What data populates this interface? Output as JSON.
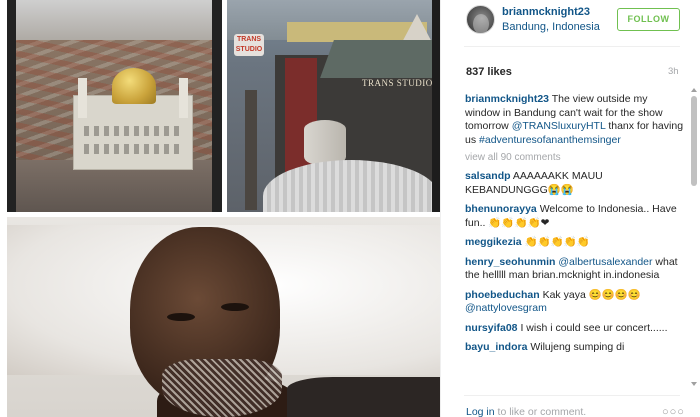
{
  "header": {
    "username": "brianmcknight23",
    "location": "Bandung, Indonesia",
    "follow_label": "FOLLOW"
  },
  "stats": {
    "likes": "837 likes",
    "time": "3h"
  },
  "photos": {
    "hotel_sign": "TRANS STUDIO A",
    "logo_text": "TRANS STUDIO"
  },
  "caption": {
    "user": "brianmcknight23",
    "text": "The view outside my window in Bandung can't wait for the show tomorrow",
    "mention": "@TRANSluxuryHTL",
    "text2": "thanx for having us",
    "hashtag": "#adventuresofananthemsinger"
  },
  "view_all": "view all 90 comments",
  "comments": [
    {
      "user": "salsandp",
      "text": "AAAAAAKK MAUU KEBANDUNGGG😭😭"
    },
    {
      "user": "bhenunorayya",
      "text": "Welcome to Indonesia.. Have fun.. 👏👏👏👏❤"
    },
    {
      "user": "meggikezia",
      "text": "👏👏👏👏👏"
    },
    {
      "user": "henry_seohunmin",
      "mention": "@albertusalexander",
      "text": "what the helllll man brian.mcknight in.indonesia"
    },
    {
      "user": "phoebeduchan",
      "text": "Kak yaya 😊😊😊😊",
      "mention2": "@nattylovesgram"
    },
    {
      "user": "nursyifa08",
      "text": "I wish i could see ur concert......"
    },
    {
      "user": "bayu_indora",
      "text": "Wilujeng sumping di"
    }
  ],
  "footer": {
    "login_link": "Log in",
    "login_rest": "to like or comment.",
    "more_icon": "more-horizontal-icon"
  },
  "colors": {
    "link_blue": "#125688",
    "follow_green": "#70c050",
    "muted_gray": "#a5a7aa"
  }
}
